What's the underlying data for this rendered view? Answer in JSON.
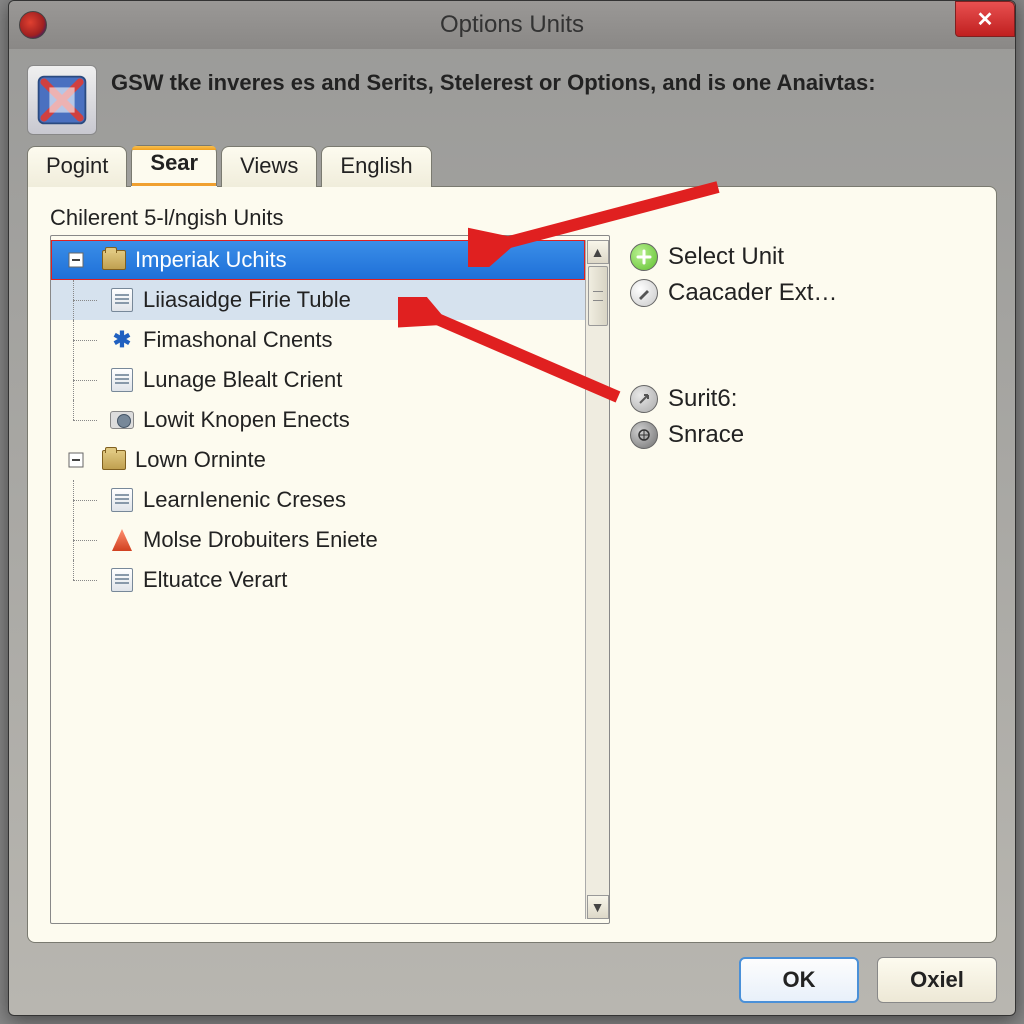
{
  "window": {
    "title": "Options Units"
  },
  "header": {
    "description": "GSW tke inveres es and Serits, Stelerest or Options, and is one Anaivtas:"
  },
  "tabs": [
    {
      "label": "Pogint",
      "active": false
    },
    {
      "label": "Sear",
      "active": true
    },
    {
      "label": "Views",
      "active": false
    },
    {
      "label": "English",
      "active": false
    }
  ],
  "panel": {
    "title": "Chilerent 5-l/ngish Units"
  },
  "tree": {
    "items": [
      {
        "label": "Imperiak Uchits",
        "depth": 0,
        "icon": "folder",
        "selected": true
      },
      {
        "label": "Liiasaidge Firie Tuble",
        "depth": 1,
        "icon": "doc",
        "sub": true
      },
      {
        "label": "Fimashonal Cnents",
        "depth": 1,
        "icon": "asterisk"
      },
      {
        "label": "Lunage Blealt Crient",
        "depth": 1,
        "icon": "doc"
      },
      {
        "label": "Lowit Knopen Enects",
        "depth": 1,
        "icon": "camera",
        "last": true
      },
      {
        "label": "Lown Orninte",
        "depth": 0,
        "icon": "folder"
      },
      {
        "label": "LearnIenenic Creses",
        "depth": 1,
        "icon": "doc"
      },
      {
        "label": "Molse Drobuiters Eniete",
        "depth": 1,
        "icon": "red"
      },
      {
        "label": "Eltuatce Verart",
        "depth": 1,
        "icon": "doc",
        "last": true
      }
    ]
  },
  "side": {
    "select_unit": "Select Unit",
    "caacader": "Caacader Ext…",
    "surit": "Surit6:",
    "snrace": "Snrace"
  },
  "buttons": {
    "ok": "OK",
    "cancel": "Oxiel"
  }
}
